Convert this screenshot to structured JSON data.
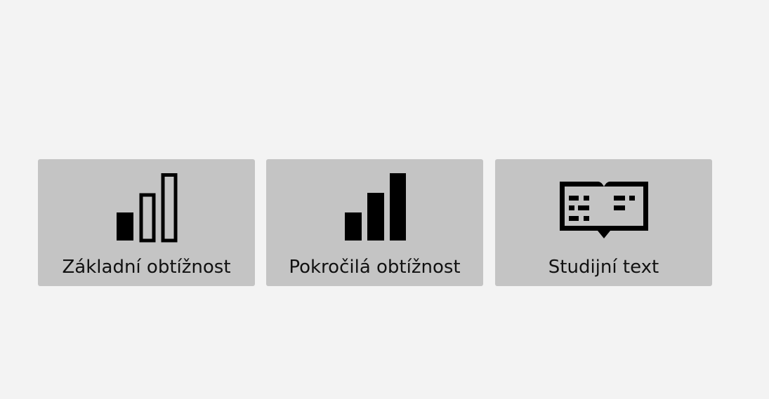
{
  "tiles": [
    {
      "id": "basic",
      "label": "Základní obtížnost",
      "icon": "signal-bars-partial-icon",
      "level_filled_bars": 1,
      "level_total_bars": 3
    },
    {
      "id": "advanced",
      "label": "Pokročilá obtížnost",
      "icon": "signal-bars-full-icon",
      "level_filled_bars": 3,
      "level_total_bars": 3
    },
    {
      "id": "study",
      "label": "Studijní text",
      "icon": "open-book-icon"
    }
  ],
  "colors": {
    "background": "#f3f3f3",
    "tile": "#c4c4c4",
    "icon": "#000000",
    "text": "#111111"
  }
}
